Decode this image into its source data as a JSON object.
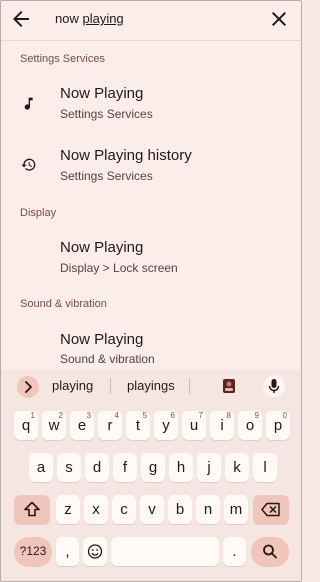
{
  "search": {
    "query_typed": "now ",
    "query_suggestion": "playing"
  },
  "sections": [
    {
      "header": "Settings Services",
      "results": [
        {
          "title": "Now Playing",
          "subtitle": "Settings Services",
          "icon": "music-note-icon"
        },
        {
          "title": "Now Playing history",
          "subtitle": "Settings Services",
          "icon": "history-icon"
        }
      ]
    },
    {
      "header": "Display",
      "results": [
        {
          "title": "Now Playing",
          "subtitle": "Display > Lock screen",
          "icon": ""
        }
      ]
    },
    {
      "header": "Sound & vibration",
      "results": [
        {
          "title": "Now Playing",
          "subtitle": "Sound & vibration",
          "icon": ""
        }
      ]
    }
  ],
  "keyboard": {
    "suggestions": [
      "playing",
      "playings"
    ],
    "row1": [
      {
        "k": "q",
        "n": "1"
      },
      {
        "k": "w",
        "n": "2"
      },
      {
        "k": "e",
        "n": "3"
      },
      {
        "k": "r",
        "n": "4"
      },
      {
        "k": "t",
        "n": "5"
      },
      {
        "k": "y",
        "n": "6"
      },
      {
        "k": "u",
        "n": "7"
      },
      {
        "k": "i",
        "n": "8"
      },
      {
        "k": "o",
        "n": "9"
      },
      {
        "k": "p",
        "n": "0"
      }
    ],
    "row2": [
      "a",
      "s",
      "d",
      "f",
      "g",
      "h",
      "j",
      "k",
      "l"
    ],
    "row3": [
      "z",
      "x",
      "c",
      "v",
      "b",
      "n",
      "m"
    ],
    "symbols_label": "?123",
    "comma": ",",
    "period": ".",
    "colors": {
      "accent": "#f0c6bb",
      "key": "#fffaf8",
      "section_header": "#7b4c3e"
    }
  }
}
